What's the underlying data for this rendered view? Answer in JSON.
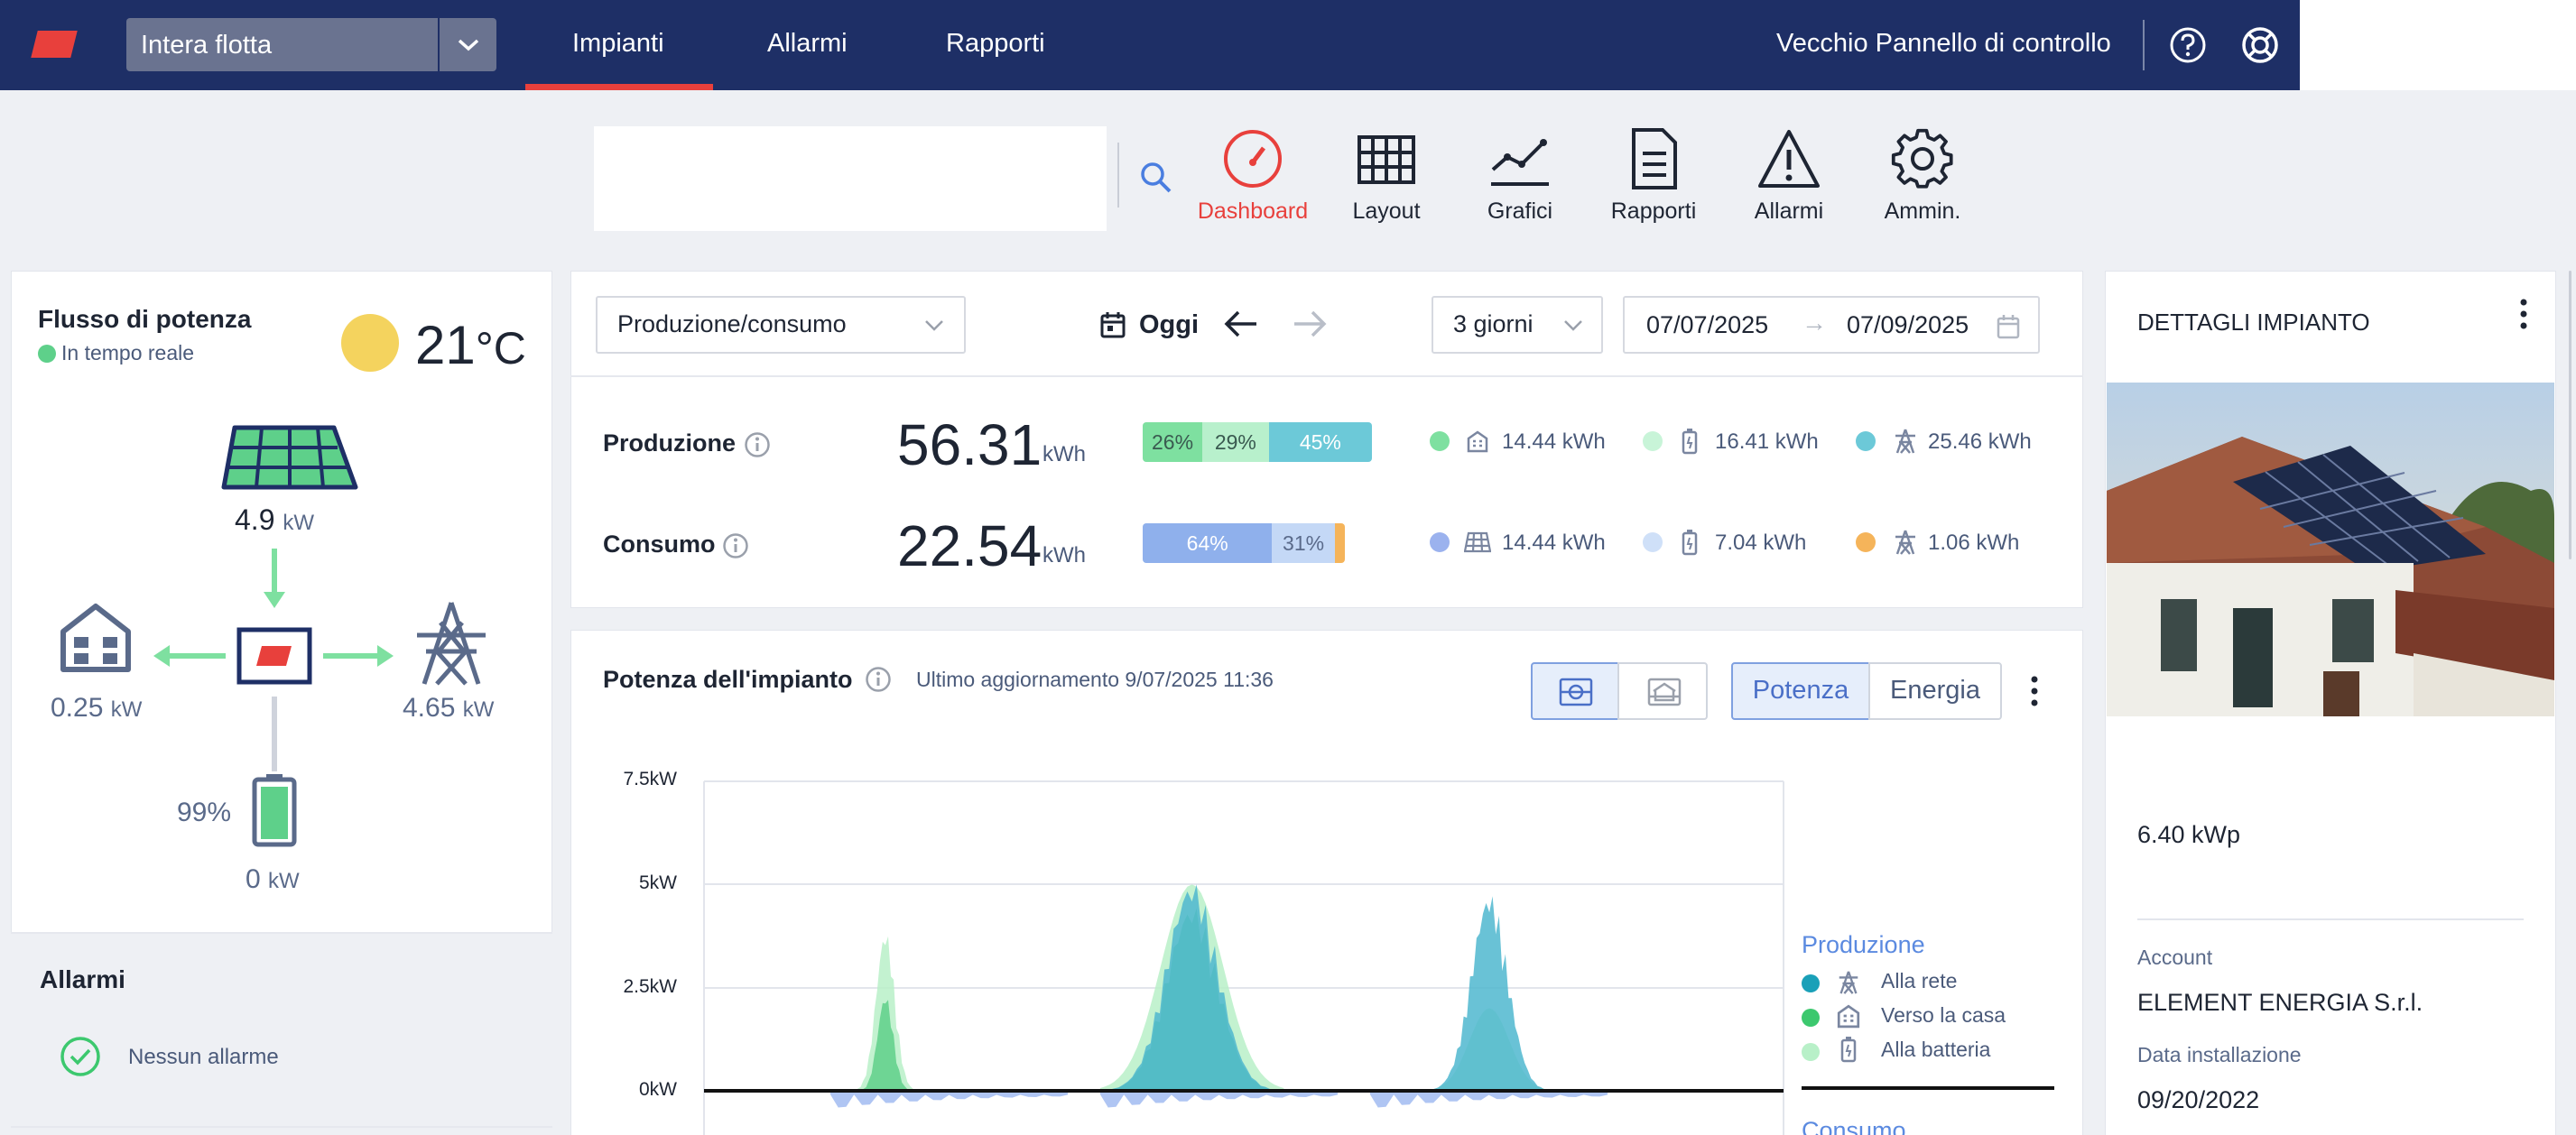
{
  "nav": {
    "fleet_label": "Intera flotta",
    "links": [
      "Impianti",
      "Allarmi",
      "Rapporti"
    ],
    "active_link": "Impianti",
    "old_panel": "Vecchio Pannello di controllo",
    "accent": "#e8403c",
    "bg": "#1e2f66"
  },
  "toolbar": {
    "search_placeholder": "",
    "items": [
      {
        "label": "Dashboard",
        "icon": "gauge-icon",
        "active": true
      },
      {
        "label": "Layout",
        "icon": "grid-icon"
      },
      {
        "label": "Grafici",
        "icon": "line-chart-icon"
      },
      {
        "label": "Rapporti",
        "icon": "document-icon"
      },
      {
        "label": "Allarmi",
        "icon": "warning-icon"
      },
      {
        "label": "Ammin.",
        "icon": "gear-icon"
      }
    ]
  },
  "flow": {
    "title": "Flusso di potenza",
    "realtime": "In tempo reale",
    "temp_value": "21",
    "temp_unit": "°C",
    "solar_value": "4.9",
    "home_value": "0.25",
    "grid_value": "4.65",
    "battery_percent": "99%",
    "battery_value": "0",
    "unit": "kW"
  },
  "alarms": {
    "title": "Allarmi",
    "none": "Nessun allarme"
  },
  "summary": {
    "mode": "Produzione/consumo",
    "today": "Oggi",
    "range": "3 giorni",
    "date_from": "07/07/2025",
    "date_to": "07/09/2025",
    "arrow": "→",
    "production": {
      "label": "Produzione",
      "value": "56.31",
      "unit": "kWh",
      "bar": [
        {
          "label": "26%",
          "pct": 26,
          "color": "#7ee0a0"
        },
        {
          "label": "29%",
          "pct": 29,
          "color": "#b8f0cc"
        },
        {
          "label": "45%",
          "pct": 45,
          "color": "#6cc9d8"
        }
      ],
      "breakdown": [
        {
          "value": "14.44",
          "unit": "kWh",
          "color": "#7ee0a0",
          "icon": "home-icon"
        },
        {
          "value": "16.41",
          "unit": "kWh",
          "color": "#c8f4d8",
          "icon": "battery-icon"
        },
        {
          "value": "25.46",
          "unit": "kWh",
          "color": "#6cc9d8",
          "icon": "pylon-icon"
        }
      ]
    },
    "consumption": {
      "label": "Consumo",
      "value": "22.54",
      "unit": "kWh",
      "bar": [
        {
          "label": "64%",
          "pct": 64,
          "color": "#8fb0ec"
        },
        {
          "label": "31%",
          "pct": 31,
          "color": "#c4d8f6"
        },
        {
          "label": "",
          "pct": 5,
          "color": "#f5b45a"
        }
      ],
      "breakdown": [
        {
          "value": "14.44",
          "unit": "kWh",
          "color": "#9bb2ee",
          "icon": "solar-panel-icon"
        },
        {
          "value": "7.04",
          "unit": "kWh",
          "color": "#cfe0f8",
          "icon": "battery-icon"
        },
        {
          "value": "1.06",
          "unit": "kWh",
          "color": "#f5b45a",
          "icon": "pylon-icon"
        }
      ]
    }
  },
  "chart_panel": {
    "title": "Potenza dell'impianto",
    "updated": "Ultimo aggiornamento 9/07/2025 11:36",
    "btn_power": "Potenza",
    "btn_energy": "Energia"
  },
  "chart_data": {
    "type": "area",
    "y_ticks": [
      "7.5kW",
      "5kW",
      "2.5kW",
      "0kW"
    ],
    "ylim": [
      0,
      7.5
    ],
    "grid": true,
    "legend_position": "right",
    "series": [
      {
        "name": "Alla rete",
        "color": "#4fb7cf",
        "days_peak": [
          0.1,
          5.2,
          4.9
        ]
      },
      {
        "name": "Verso la casa",
        "color": "#5fd08a",
        "days_peak": [
          4.0,
          4.6,
          1.5
        ]
      },
      {
        "name": "Alla batteria",
        "color": "#b8f0c8",
        "days_peak": [
          4.0,
          5.0,
          2.0
        ]
      }
    ],
    "legend": {
      "production_title": "Produzione",
      "items": [
        {
          "label": "Alla rete",
          "color": "#1aa0b8",
          "icon": "pylon-icon"
        },
        {
          "label": "Verso la casa",
          "color": "#3cc86e",
          "icon": "home-icon"
        },
        {
          "label": "Alla batteria",
          "color": "#b8f0c8",
          "icon": "battery-icon"
        }
      ],
      "consumption_title": "Consumo"
    }
  },
  "details": {
    "title": "DETTAGLI IMPIANTO",
    "peak_power": "6.40 kWp",
    "account_label": "Account",
    "account": "ELEMENT ENERGIA S.r.l.",
    "install_label": "Data installazione",
    "install_date": "09/20/2022"
  }
}
